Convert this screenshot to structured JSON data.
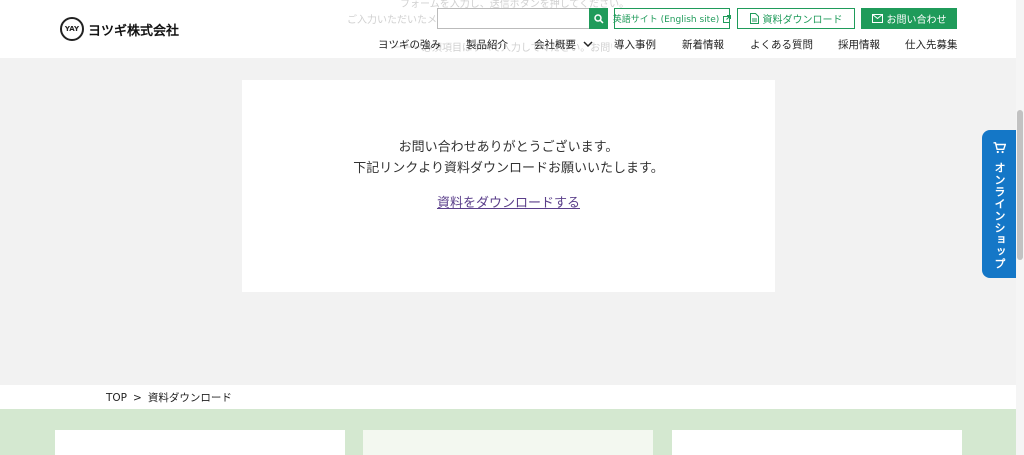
{
  "header": {
    "logo_text": "ヨツギ株式会社",
    "logo_mark": "YAY",
    "ghost_lines": [
      "フォームを入力し、送信ボタンを押してください。",
      "ご入力いただいたメ",
      "ーーー必須項目はすべて入力してください。お問い合わせの内容によっては回答にお時間をいただく場合がございます。"
    ],
    "search": {
      "value": "",
      "placeholder": ""
    },
    "english_site_label": "英語サイト (English site)",
    "download_label": "資料ダウンロード",
    "contact_label": "お問い合わせ"
  },
  "nav": [
    {
      "label": "ヨツギの強み"
    },
    {
      "label": "製品紹介"
    },
    {
      "label": "会社概要"
    },
    {
      "label": "導入事例"
    },
    {
      "label": "新着情報"
    },
    {
      "label": "よくある質問"
    },
    {
      "label": "採用情報"
    },
    {
      "label": "仕入先募集"
    }
  ],
  "card": {
    "line1": "お問い合わせありがとうございます。",
    "line2": "下記リンクより資料ダウンロードお願いいたします。",
    "link": "資料をダウンロードする"
  },
  "shop_tab": {
    "label": "オンラインショップ"
  },
  "breadcrumb": {
    "home": "TOP",
    "separator": ">",
    "current": "資料ダウンロード"
  },
  "colors": {
    "brand_green": "#1f9b5a",
    "shop_blue": "#1477c7",
    "link_purple": "#5a3e8a",
    "bottom_bg": "#d4e8d0"
  },
  "icons": {
    "search": "search-icon",
    "external": "external-link-icon",
    "document": "document-icon",
    "mail": "mail-icon",
    "cart": "cart-icon",
    "chevron": "chevron-down-icon"
  }
}
